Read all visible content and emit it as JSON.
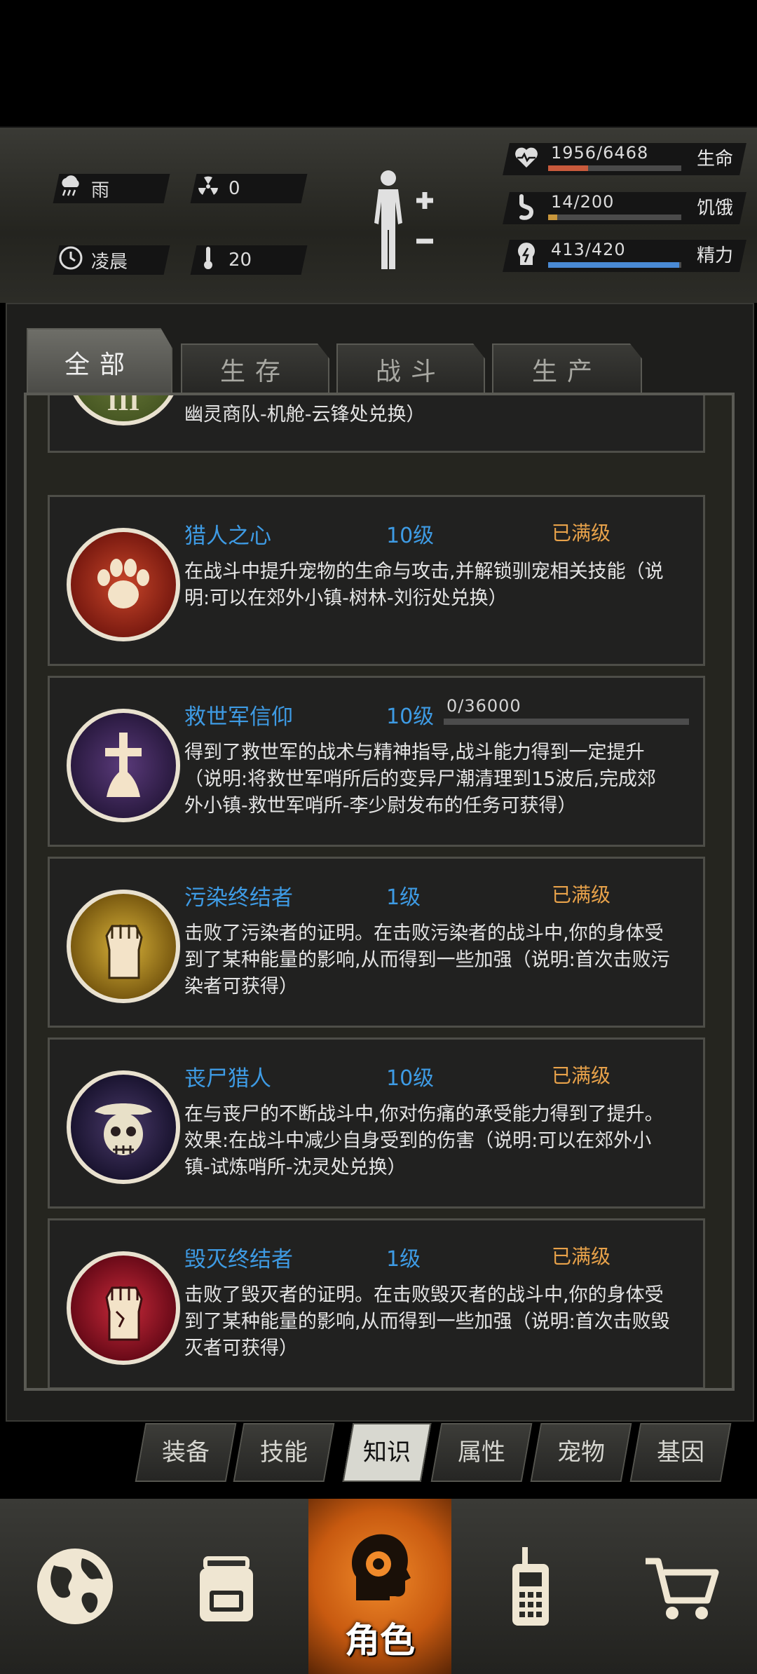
{
  "status": {
    "weather": {
      "icon": "rain-cloud-icon",
      "label": "雨"
    },
    "radiation": {
      "icon": "radiation-icon",
      "value": "0"
    },
    "time": {
      "icon": "clock-icon",
      "label": "凌晨"
    },
    "temperature": {
      "icon": "thermometer-icon",
      "value": "20"
    },
    "stats": [
      {
        "key": "life",
        "icon": "heart-pulse-icon",
        "value": "1956/6468",
        "label": "生命",
        "fraction": 0.302,
        "color": "#c85a3c"
      },
      {
        "key": "hunger",
        "icon": "stomach-icon",
        "value": "14/200",
        "label": "饥饿",
        "fraction": 0.07,
        "color": "#c8963c"
      },
      {
        "key": "energy",
        "icon": "energy-head-icon",
        "value": "413/420",
        "label": "精力",
        "fraction": 0.983,
        "color": "#4a8ad4"
      }
    ]
  },
  "tabs": [
    {
      "label": "全部",
      "active": true
    },
    {
      "label": "生存",
      "active": false
    },
    {
      "label": "战斗",
      "active": false
    },
    {
      "label": "生产",
      "active": false
    }
  ],
  "skills": [
    {
      "name": "",
      "level": "",
      "status": "",
      "desc": "幽灵商队-机舱-云锋处兑换）",
      "icon": "roman-three-badge-icon"
    },
    {
      "name": "猎人之心",
      "level": "10级",
      "status": "已满级",
      "desc": "在战斗中提升宠物的生命与攻击,并解锁驯宠相关技能（说明:可以在郊外小镇-树林-刘衍处兑换）",
      "icon": "paw-icon"
    },
    {
      "name": "救世军信仰",
      "level": "10级",
      "status": "",
      "progress_text": "0/36000",
      "progress": 0,
      "desc": "得到了救世军的战术与精神指导,战斗能力得到一定提升（说明:将救世军哨所后的变异尸潮清理到15波后,完成郊外小镇-救世军哨所-李少尉发布的任务可获得）",
      "icon": "praying-cross-icon"
    },
    {
      "name": "污染终结者",
      "level": "1级",
      "status": "已满级",
      "desc": "击败了污染者的证明。在击败污染者的战斗中,你的身体受到了某种能量的影响,从而得到一些加强（说明:首次击败污染者可获得）",
      "icon": "raised-fist-icon"
    },
    {
      "name": "丧尸猎人",
      "level": "10级",
      "status": "已满级",
      "desc": "在与丧尸的不断战斗中,你对伤痛的承受能力得到了提升。效果:在战斗中减少自身受到的伤害（说明:可以在郊外小镇-试炼哨所-沈灵处兑换）",
      "icon": "skull-hat-icon"
    },
    {
      "name": "毁灭终结者",
      "level": "1级",
      "status": "已满级",
      "desc": "击败了毁灭者的证明。在击败毁灭者的战斗中,你的身体受到了某种能量的影响,从而得到一些加强（说明:首次击败毁灭者可获得）",
      "icon": "cracked-fist-icon"
    }
  ],
  "categories": [
    {
      "label": "装备",
      "active": false
    },
    {
      "label": "技能",
      "active": false
    },
    {
      "label": "知识",
      "active": true
    },
    {
      "label": "属性",
      "active": false
    },
    {
      "label": "宠物",
      "active": false
    },
    {
      "label": "基因",
      "active": false
    }
  ],
  "nav": [
    {
      "icon": "globe-icon",
      "label": ""
    },
    {
      "icon": "backpack-icon",
      "label": ""
    },
    {
      "icon": "character-head-icon",
      "label": "角色",
      "active": true
    },
    {
      "icon": "walkie-talkie-icon",
      "label": ""
    },
    {
      "icon": "shopping-cart-icon",
      "label": ""
    }
  ]
}
